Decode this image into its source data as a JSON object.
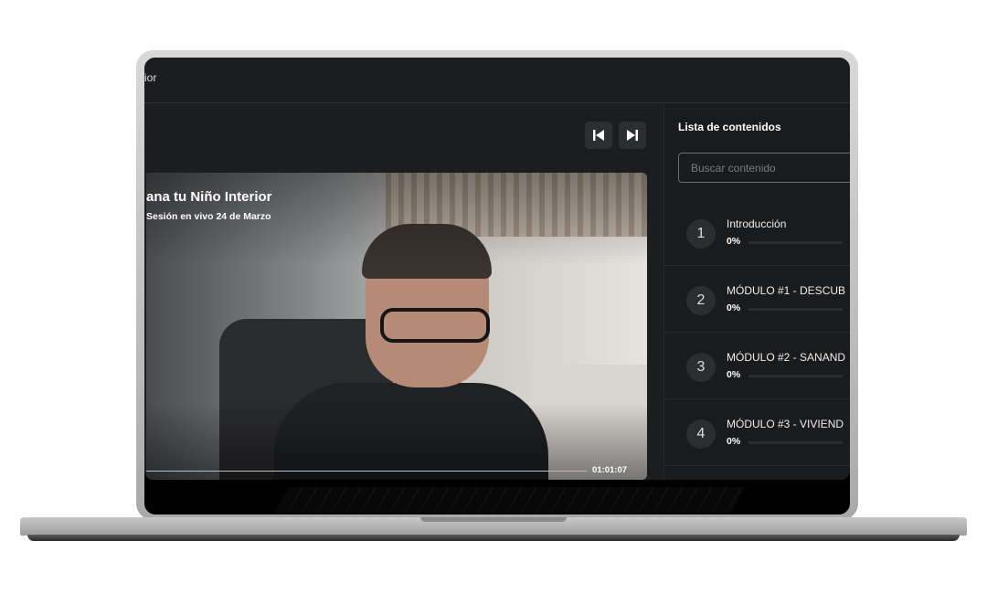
{
  "course": {
    "title_fragment": "ior"
  },
  "player": {
    "video_title": "ana tu Niño Interior",
    "video_subtitle": "Sesión en vivo 24 de Marzo",
    "time": "01:01:07",
    "progress": 0.9
  },
  "sidebar": {
    "title": "Lista de contenidos",
    "search_placeholder": "Buscar contenido",
    "items": [
      {
        "num": "1",
        "name": "Introducción",
        "percent": "0%",
        "progress": 0
      },
      {
        "num": "2",
        "name": "MÓDULO #1 - DESCUB",
        "percent": "0%",
        "progress": 0
      },
      {
        "num": "3",
        "name": "MÓDULO #2 - SANAND",
        "percent": "0%",
        "progress": 0
      },
      {
        "num": "4",
        "name": "MÓDULO #3 - VIVIEND",
        "percent": "0%",
        "progress": 0
      }
    ]
  },
  "icons": {
    "prev": "skip-previous-icon",
    "next": "skip-next-icon"
  }
}
